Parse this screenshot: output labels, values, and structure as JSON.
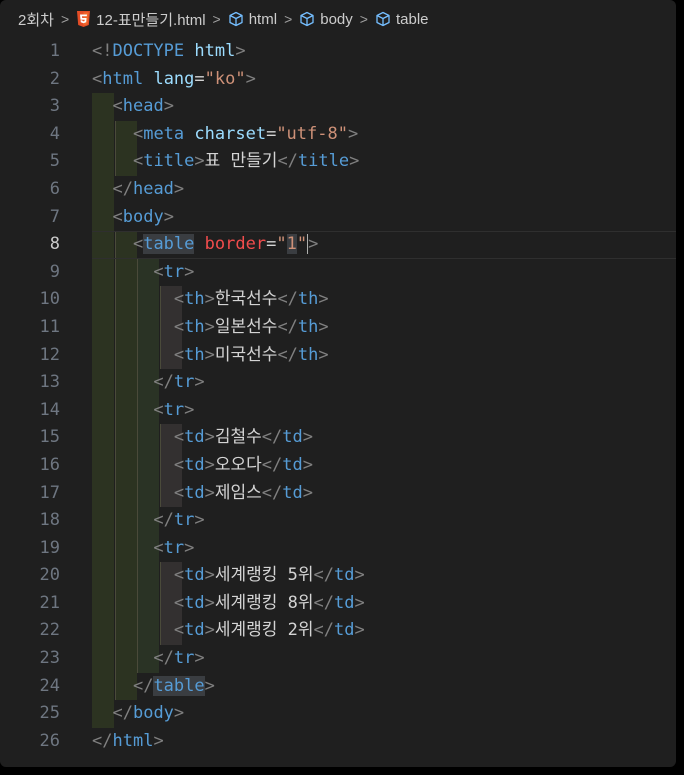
{
  "breadcrumb": {
    "folder": "2회차",
    "file": "12-표만들기.html",
    "path": [
      "html",
      "body",
      "table"
    ]
  },
  "editor": {
    "active_line": 8,
    "lines": [
      {
        "n": "1",
        "parts": [
          {
            "t": "<!",
            "c": "pun"
          },
          {
            "t": "DOCTYPE",
            "c": "kw"
          },
          {
            "t": " ",
            "c": "plain"
          },
          {
            "t": "html",
            "c": "attr"
          },
          {
            "t": ">",
            "c": "pun"
          }
        ]
      },
      {
        "n": "2",
        "parts": [
          {
            "t": "<",
            "c": "pun"
          },
          {
            "t": "html",
            "c": "tag"
          },
          {
            "t": " ",
            "c": "plain"
          },
          {
            "t": "lang",
            "c": "attr"
          },
          {
            "t": "=",
            "c": "plain"
          },
          {
            "t": "\"ko\"",
            "c": "str"
          },
          {
            "t": ">",
            "c": "pun"
          }
        ]
      },
      {
        "n": "3",
        "parts": [
          {
            "t": "  ",
            "c": "plain"
          },
          {
            "t": "<",
            "c": "pun"
          },
          {
            "t": "head",
            "c": "tag"
          },
          {
            "t": ">",
            "c": "pun"
          }
        ]
      },
      {
        "n": "4",
        "parts": [
          {
            "t": "    ",
            "c": "plain"
          },
          {
            "t": "<",
            "c": "pun"
          },
          {
            "t": "meta",
            "c": "tag"
          },
          {
            "t": " ",
            "c": "plain"
          },
          {
            "t": "charset",
            "c": "attr"
          },
          {
            "t": "=",
            "c": "plain"
          },
          {
            "t": "\"utf-8\"",
            "c": "str"
          },
          {
            "t": ">",
            "c": "pun"
          }
        ]
      },
      {
        "n": "5",
        "parts": [
          {
            "t": "    ",
            "c": "plain"
          },
          {
            "t": "<",
            "c": "pun"
          },
          {
            "t": "title",
            "c": "tag"
          },
          {
            "t": ">",
            "c": "pun"
          },
          {
            "t": "표 만들기",
            "c": "plain"
          },
          {
            "t": "</",
            "c": "pun"
          },
          {
            "t": "title",
            "c": "tag"
          },
          {
            "t": ">",
            "c": "pun"
          }
        ]
      },
      {
        "n": "6",
        "parts": [
          {
            "t": "  ",
            "c": "plain"
          },
          {
            "t": "</",
            "c": "pun"
          },
          {
            "t": "head",
            "c": "tag"
          },
          {
            "t": ">",
            "c": "pun"
          }
        ]
      },
      {
        "n": "7",
        "parts": [
          {
            "t": "  ",
            "c": "plain"
          },
          {
            "t": "<",
            "c": "pun"
          },
          {
            "t": "body",
            "c": "tag"
          },
          {
            "t": ">",
            "c": "pun"
          }
        ]
      },
      {
        "n": "8",
        "parts": [
          {
            "t": "    ",
            "c": "plain"
          },
          {
            "t": "<",
            "c": "pun"
          },
          {
            "t": "table",
            "c": "tag hl"
          },
          {
            "t": " ",
            "c": "plain"
          },
          {
            "t": "border",
            "c": "attr-hot"
          },
          {
            "t": "=",
            "c": "plain"
          },
          {
            "t": "\"",
            "c": "str"
          },
          {
            "t": "1",
            "c": "str hl"
          },
          {
            "t": "\"",
            "c": "str"
          },
          {
            "t": "|",
            "c": "cursor"
          },
          {
            "t": ">",
            "c": "pun"
          }
        ]
      },
      {
        "n": "9",
        "parts": [
          {
            "t": "      ",
            "c": "plain"
          },
          {
            "t": "<",
            "c": "pun"
          },
          {
            "t": "tr",
            "c": "tag"
          },
          {
            "t": ">",
            "c": "pun"
          }
        ]
      },
      {
        "n": "10",
        "parts": [
          {
            "t": "        ",
            "c": "plain"
          },
          {
            "t": "<",
            "c": "pun"
          },
          {
            "t": "th",
            "c": "tag"
          },
          {
            "t": ">",
            "c": "pun"
          },
          {
            "t": "한국선수",
            "c": "plain"
          },
          {
            "t": "</",
            "c": "pun"
          },
          {
            "t": "th",
            "c": "tag"
          },
          {
            "t": ">",
            "c": "pun"
          }
        ]
      },
      {
        "n": "11",
        "parts": [
          {
            "t": "        ",
            "c": "plain"
          },
          {
            "t": "<",
            "c": "pun"
          },
          {
            "t": "th",
            "c": "tag"
          },
          {
            "t": ">",
            "c": "pun"
          },
          {
            "t": "일본선수",
            "c": "plain"
          },
          {
            "t": "</",
            "c": "pun"
          },
          {
            "t": "th",
            "c": "tag"
          },
          {
            "t": ">",
            "c": "pun"
          }
        ]
      },
      {
        "n": "12",
        "parts": [
          {
            "t": "        ",
            "c": "plain"
          },
          {
            "t": "<",
            "c": "pun"
          },
          {
            "t": "th",
            "c": "tag"
          },
          {
            "t": ">",
            "c": "pun"
          },
          {
            "t": "미국선수",
            "c": "plain"
          },
          {
            "t": "</",
            "c": "pun"
          },
          {
            "t": "th",
            "c": "tag"
          },
          {
            "t": ">",
            "c": "pun"
          }
        ]
      },
      {
        "n": "13",
        "parts": [
          {
            "t": "      ",
            "c": "plain"
          },
          {
            "t": "</",
            "c": "pun"
          },
          {
            "t": "tr",
            "c": "tag"
          },
          {
            "t": ">",
            "c": "pun"
          }
        ]
      },
      {
        "n": "14",
        "parts": [
          {
            "t": "      ",
            "c": "plain"
          },
          {
            "t": "<",
            "c": "pun"
          },
          {
            "t": "tr",
            "c": "tag"
          },
          {
            "t": ">",
            "c": "pun"
          }
        ]
      },
      {
        "n": "15",
        "parts": [
          {
            "t": "        ",
            "c": "plain"
          },
          {
            "t": "<",
            "c": "pun"
          },
          {
            "t": "td",
            "c": "tag"
          },
          {
            "t": ">",
            "c": "pun"
          },
          {
            "t": "김철수",
            "c": "plain"
          },
          {
            "t": "</",
            "c": "pun"
          },
          {
            "t": "td",
            "c": "tag"
          },
          {
            "t": ">",
            "c": "pun"
          }
        ]
      },
      {
        "n": "16",
        "parts": [
          {
            "t": "        ",
            "c": "plain"
          },
          {
            "t": "<",
            "c": "pun"
          },
          {
            "t": "td",
            "c": "tag"
          },
          {
            "t": ">",
            "c": "pun"
          },
          {
            "t": "오오다",
            "c": "plain"
          },
          {
            "t": "</",
            "c": "pun"
          },
          {
            "t": "td",
            "c": "tag"
          },
          {
            "t": ">",
            "c": "pun"
          }
        ]
      },
      {
        "n": "17",
        "parts": [
          {
            "t": "        ",
            "c": "plain"
          },
          {
            "t": "<",
            "c": "pun"
          },
          {
            "t": "td",
            "c": "tag"
          },
          {
            "t": ">",
            "c": "pun"
          },
          {
            "t": "제임스",
            "c": "plain"
          },
          {
            "t": "</",
            "c": "pun"
          },
          {
            "t": "td",
            "c": "tag"
          },
          {
            "t": ">",
            "c": "pun"
          }
        ]
      },
      {
        "n": "18",
        "parts": [
          {
            "t": "      ",
            "c": "plain"
          },
          {
            "t": "</",
            "c": "pun"
          },
          {
            "t": "tr",
            "c": "tag"
          },
          {
            "t": ">",
            "c": "pun"
          }
        ]
      },
      {
        "n": "19",
        "parts": [
          {
            "t": "      ",
            "c": "plain"
          },
          {
            "t": "<",
            "c": "pun"
          },
          {
            "t": "tr",
            "c": "tag"
          },
          {
            "t": ">",
            "c": "pun"
          }
        ]
      },
      {
        "n": "20",
        "parts": [
          {
            "t": "        ",
            "c": "plain"
          },
          {
            "t": "<",
            "c": "pun"
          },
          {
            "t": "td",
            "c": "tag"
          },
          {
            "t": ">",
            "c": "pun"
          },
          {
            "t": "세계랭킹 5위",
            "c": "plain"
          },
          {
            "t": "</",
            "c": "pun"
          },
          {
            "t": "td",
            "c": "tag"
          },
          {
            "t": ">",
            "c": "pun"
          }
        ]
      },
      {
        "n": "21",
        "parts": [
          {
            "t": "        ",
            "c": "plain"
          },
          {
            "t": "<",
            "c": "pun"
          },
          {
            "t": "td",
            "c": "tag"
          },
          {
            "t": ">",
            "c": "pun"
          },
          {
            "t": "세계랭킹 8위",
            "c": "plain"
          },
          {
            "t": "</",
            "c": "pun"
          },
          {
            "t": "td",
            "c": "tag"
          },
          {
            "t": ">",
            "c": "pun"
          }
        ]
      },
      {
        "n": "22",
        "parts": [
          {
            "t": "        ",
            "c": "plain"
          },
          {
            "t": "<",
            "c": "pun"
          },
          {
            "t": "td",
            "c": "tag"
          },
          {
            "t": ">",
            "c": "pun"
          },
          {
            "t": "세계랭킹 2위",
            "c": "plain"
          },
          {
            "t": "</",
            "c": "pun"
          },
          {
            "t": "td",
            "c": "tag"
          },
          {
            "t": ">",
            "c": "pun"
          }
        ]
      },
      {
        "n": "23",
        "parts": [
          {
            "t": "      ",
            "c": "plain"
          },
          {
            "t": "</",
            "c": "pun"
          },
          {
            "t": "tr",
            "c": "tag"
          },
          {
            "t": ">",
            "c": "pun"
          }
        ]
      },
      {
        "n": "24",
        "parts": [
          {
            "t": "    ",
            "c": "plain"
          },
          {
            "t": "</",
            "c": "pun"
          },
          {
            "t": "table",
            "c": "tag hl"
          },
          {
            "t": ">",
            "c": "pun"
          }
        ]
      },
      {
        "n": "25",
        "parts": [
          {
            "t": "  ",
            "c": "plain"
          },
          {
            "t": "</",
            "c": "pun"
          },
          {
            "t": "body",
            "c": "tag"
          },
          {
            "t": ">",
            "c": "pun"
          }
        ]
      },
      {
        "n": "26",
        "parts": [
          {
            "t": "</",
            "c": "pun"
          },
          {
            "t": "html",
            "c": "tag"
          },
          {
            "t": ">",
            "c": "pun"
          }
        ]
      }
    ]
  }
}
